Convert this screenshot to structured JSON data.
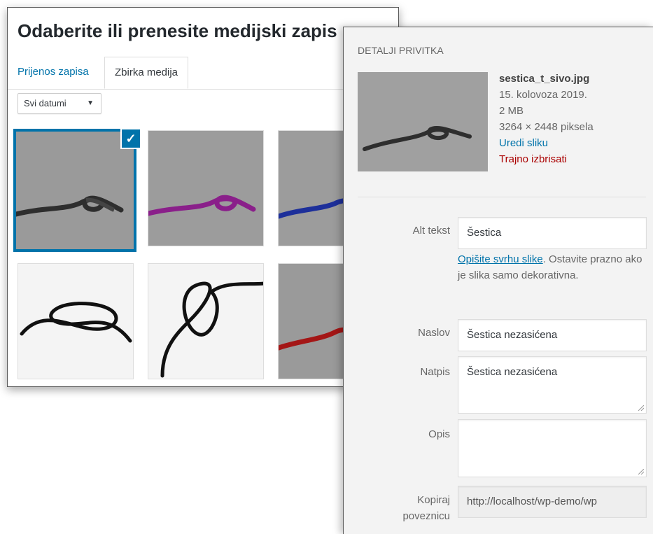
{
  "modal": {
    "title": "Odaberite ili prenesite medijski zapis",
    "tabs": [
      {
        "label": "Prijenos zapisa",
        "active": false
      },
      {
        "label": "Zbirka medija",
        "active": true
      }
    ],
    "date_filter": {
      "selected": "Svi datumi"
    },
    "selected_check_icon": "checkmark-icon",
    "accent_color": "#0073aa"
  },
  "details": {
    "heading": "DETALJI PRIVITKA",
    "filename": "sestica_t_sivo.jpg",
    "date": "15. kolovoza 2019.",
    "size": "2 MB",
    "dimensions": "3264 × 2448 piksela",
    "edit_link": "Uredi sliku",
    "delete_link": "Trajno izbrisati",
    "delete_color": "#aa0000",
    "fields": {
      "alt": {
        "label": "Alt tekst",
        "value": "Šestica"
      },
      "alt_help_link": "Opišite svrhu slike",
      "alt_help_rest": ". Ostavite prazno ako je slika samo dekorativna.",
      "title": {
        "label": "Naslov",
        "value": "Šestica nezasićena"
      },
      "caption": {
        "label": "Natpis",
        "value": "Šestica nezasićena"
      },
      "description": {
        "label": "Opis",
        "value": ""
      },
      "copy_link": {
        "label_line1": "Kopiraj",
        "label_line2": "poveznicu",
        "value": "http://localhost/wp-demo/wp"
      }
    }
  }
}
